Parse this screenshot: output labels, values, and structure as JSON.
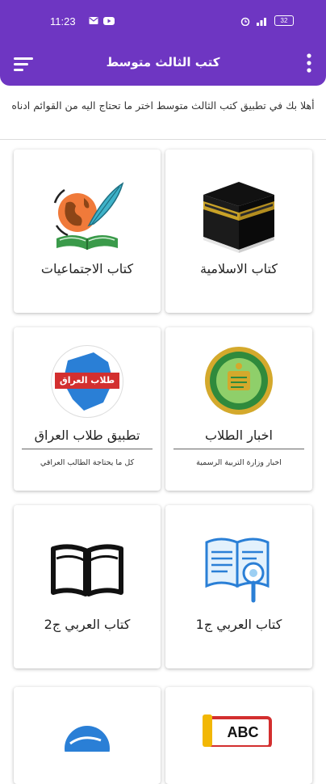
{
  "status_bar": {
    "time": "11:23",
    "battery": "32"
  },
  "app_bar": {
    "title": "كتب الثالث متوسط"
  },
  "welcome_text": "أهلا بك في تطبيق كتب الثالث متوسط اختر ما تحتاج اليه من القوائم ادناه",
  "cards": [
    {
      "label": "كتاب الاسلامية",
      "subtitle": ""
    },
    {
      "label": "كتاب الاجتماعيات",
      "subtitle": ""
    },
    {
      "label": "اخبار الطلاب",
      "subtitle": "اخبار وزارة التربية الرسمية"
    },
    {
      "label": "تطبيق طلاب العراق",
      "subtitle": "كل ما يحتاجة الطالب العراقي",
      "logo_text": "طلاب العراق"
    },
    {
      "label": "كتاب العربي ج1",
      "subtitle": ""
    },
    {
      "label": "كتاب العربي ج2",
      "subtitle": ""
    },
    {
      "label": "",
      "subtitle": ""
    },
    {
      "label": "",
      "subtitle": "",
      "art_text": "ABC"
    }
  ],
  "colors": {
    "primary": "#6e36c2",
    "accent_blue": "#2a7fd6"
  }
}
